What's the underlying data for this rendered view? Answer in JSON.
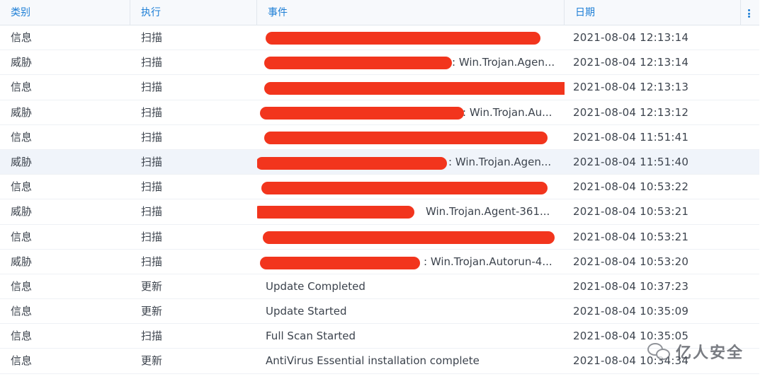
{
  "columns": [
    "类别",
    "执行",
    "事件",
    "日期"
  ],
  "rows": [
    {
      "category": "信息",
      "action": "扫描",
      "event": "",
      "date": "2021-08-04 12:13:14"
    },
    {
      "category": "威胁",
      "action": "扫描",
      "event": "Win.Trojan.Agen...",
      "date": "2021-08-04 12:13:14"
    },
    {
      "category": "信息",
      "action": "扫描",
      "event": "",
      "date": "2021-08-04 12:13:13"
    },
    {
      "category": "威胁",
      "action": "扫描",
      "event": "Win.Trojan.Au...",
      "date": "2021-08-04 12:13:12"
    },
    {
      "category": "信息",
      "action": "扫描",
      "event": "",
      "date": "2021-08-04 11:51:41"
    },
    {
      "category": "威胁",
      "action": "扫描",
      "event": "Win.Trojan.Agen...",
      "date": "2021-08-04 11:51:40"
    },
    {
      "category": "信息",
      "action": "扫描",
      "event": "",
      "date": "2021-08-04 10:53:22"
    },
    {
      "category": "威胁",
      "action": "扫描",
      "event": "Win.Trojan.Agent-361...",
      "date": "2021-08-04 10:53:21"
    },
    {
      "category": "信息",
      "action": "扫描",
      "event": "",
      "date": "2021-08-04 10:53:21"
    },
    {
      "category": "威胁",
      "action": "扫描",
      "event": "Win.Trojan.Autorun-4...",
      "date": "2021-08-04 10:53:20"
    },
    {
      "category": "信息",
      "action": "更新",
      "event": "Update Completed",
      "date": "2021-08-04 10:37:23"
    },
    {
      "category": "信息",
      "action": "更新",
      "event": "Update Started",
      "date": "2021-08-04 10:35:09"
    },
    {
      "category": "信息",
      "action": "扫描",
      "event": "Full Scan Started",
      "date": "2021-08-04 10:35:05"
    },
    {
      "category": "信息",
      "action": "更新",
      "event": "AntiVirus Essential installation complete",
      "date": "2021-08-04 10:34:34"
    }
  ],
  "watermark": "亿人安全",
  "colors": {
    "accent": "#1e7fd6",
    "redaction": "#f2351d",
    "selected_row": "#f0f4fa"
  }
}
